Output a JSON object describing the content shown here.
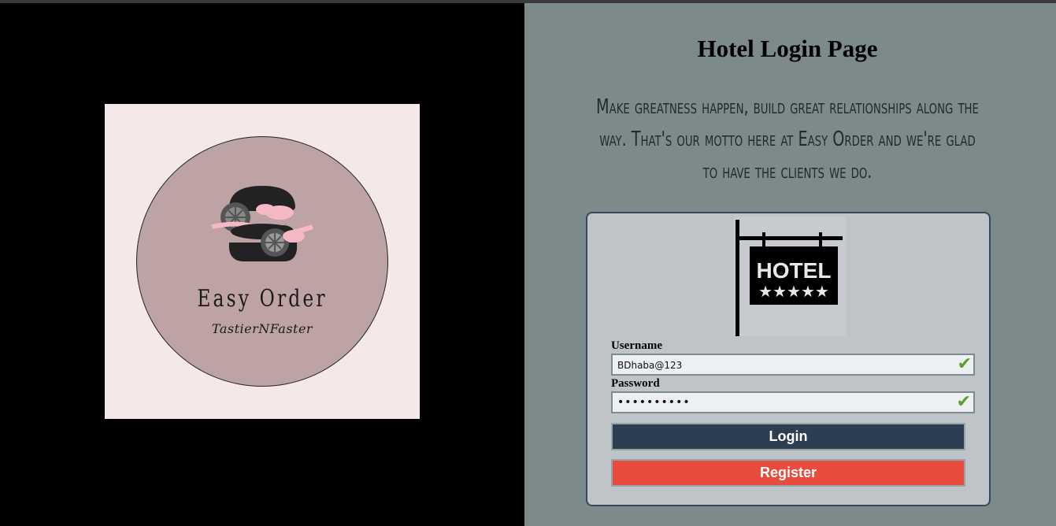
{
  "brand": {
    "name": "Easy Order",
    "tagline": "TastierNFaster"
  },
  "page": {
    "title": "Hotel Login Page",
    "motto": "Make greatness happen, build great relationships along the way. That's our motto here at Easy Order and we're glad to have the clients we do."
  },
  "sign": {
    "text": "HOTEL",
    "stars": "★★★★★"
  },
  "form": {
    "username_label": "Username",
    "username_value": "BDhaba@123",
    "password_label": "Password",
    "password_value": "••••••••••",
    "valid_mark": "✔",
    "login_label": "Login",
    "register_label": "Register"
  },
  "colors": {
    "left_bg": "#000000",
    "right_bg": "#7d8a8a",
    "card_bg": "#bfc4c8",
    "login_btn": "#2c3e50",
    "register_btn": "#e74c3c",
    "logo_bg": "#f4e8e9",
    "logo_circle": "#bea3a4"
  }
}
